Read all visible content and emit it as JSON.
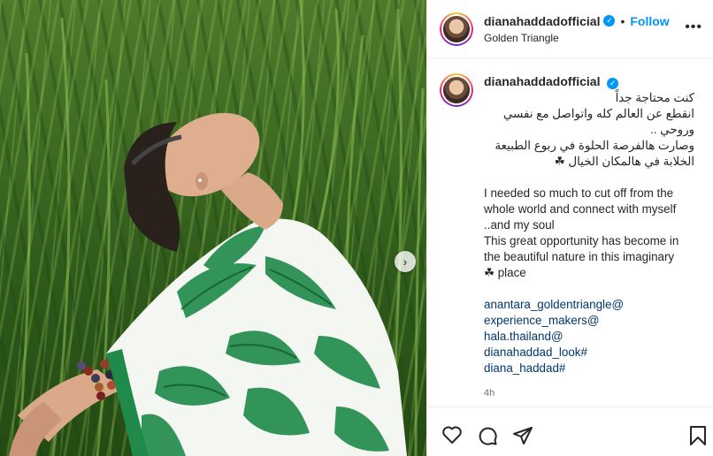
{
  "post": {
    "username": "dianahaddadofficial",
    "follow_label": "Follow",
    "separator": "•",
    "location": "Golden Triangle",
    "more_label": "•••",
    "carousel_next": "›"
  },
  "caption": {
    "username": "dianahaddadofficial",
    "arabic_lines": [
      "كنت محتاجة جداً",
      "انقطع عن العالم كله واتواصل مع نفسي",
      "وروحي ..",
      "وصارت هالفرصة الحلوة في ربوع الطبيعة",
      "الخلابة في هالمكان الخيال ☘"
    ],
    "english_lines": [
      "I needed so much to cut off from the",
      "whole world and connect with myself",
      "..and my soul",
      "This great opportunity has become in",
      "the beautiful nature in this imaginary",
      "☘ place"
    ],
    "tags": [
      "anantara_goldentriangle@",
      "experience_makers@",
      "hala.thailand@",
      "dianahaddad_look#",
      "diana_haddad#"
    ],
    "time": "4h"
  },
  "icons": {
    "verified": "verified-badge-icon",
    "like": "heart-icon",
    "comment": "comment-icon",
    "share": "share-icon",
    "save": "bookmark-icon"
  },
  "colors": {
    "link": "#0095f6",
    "tag": "#00376b",
    "muted": "#737373"
  }
}
